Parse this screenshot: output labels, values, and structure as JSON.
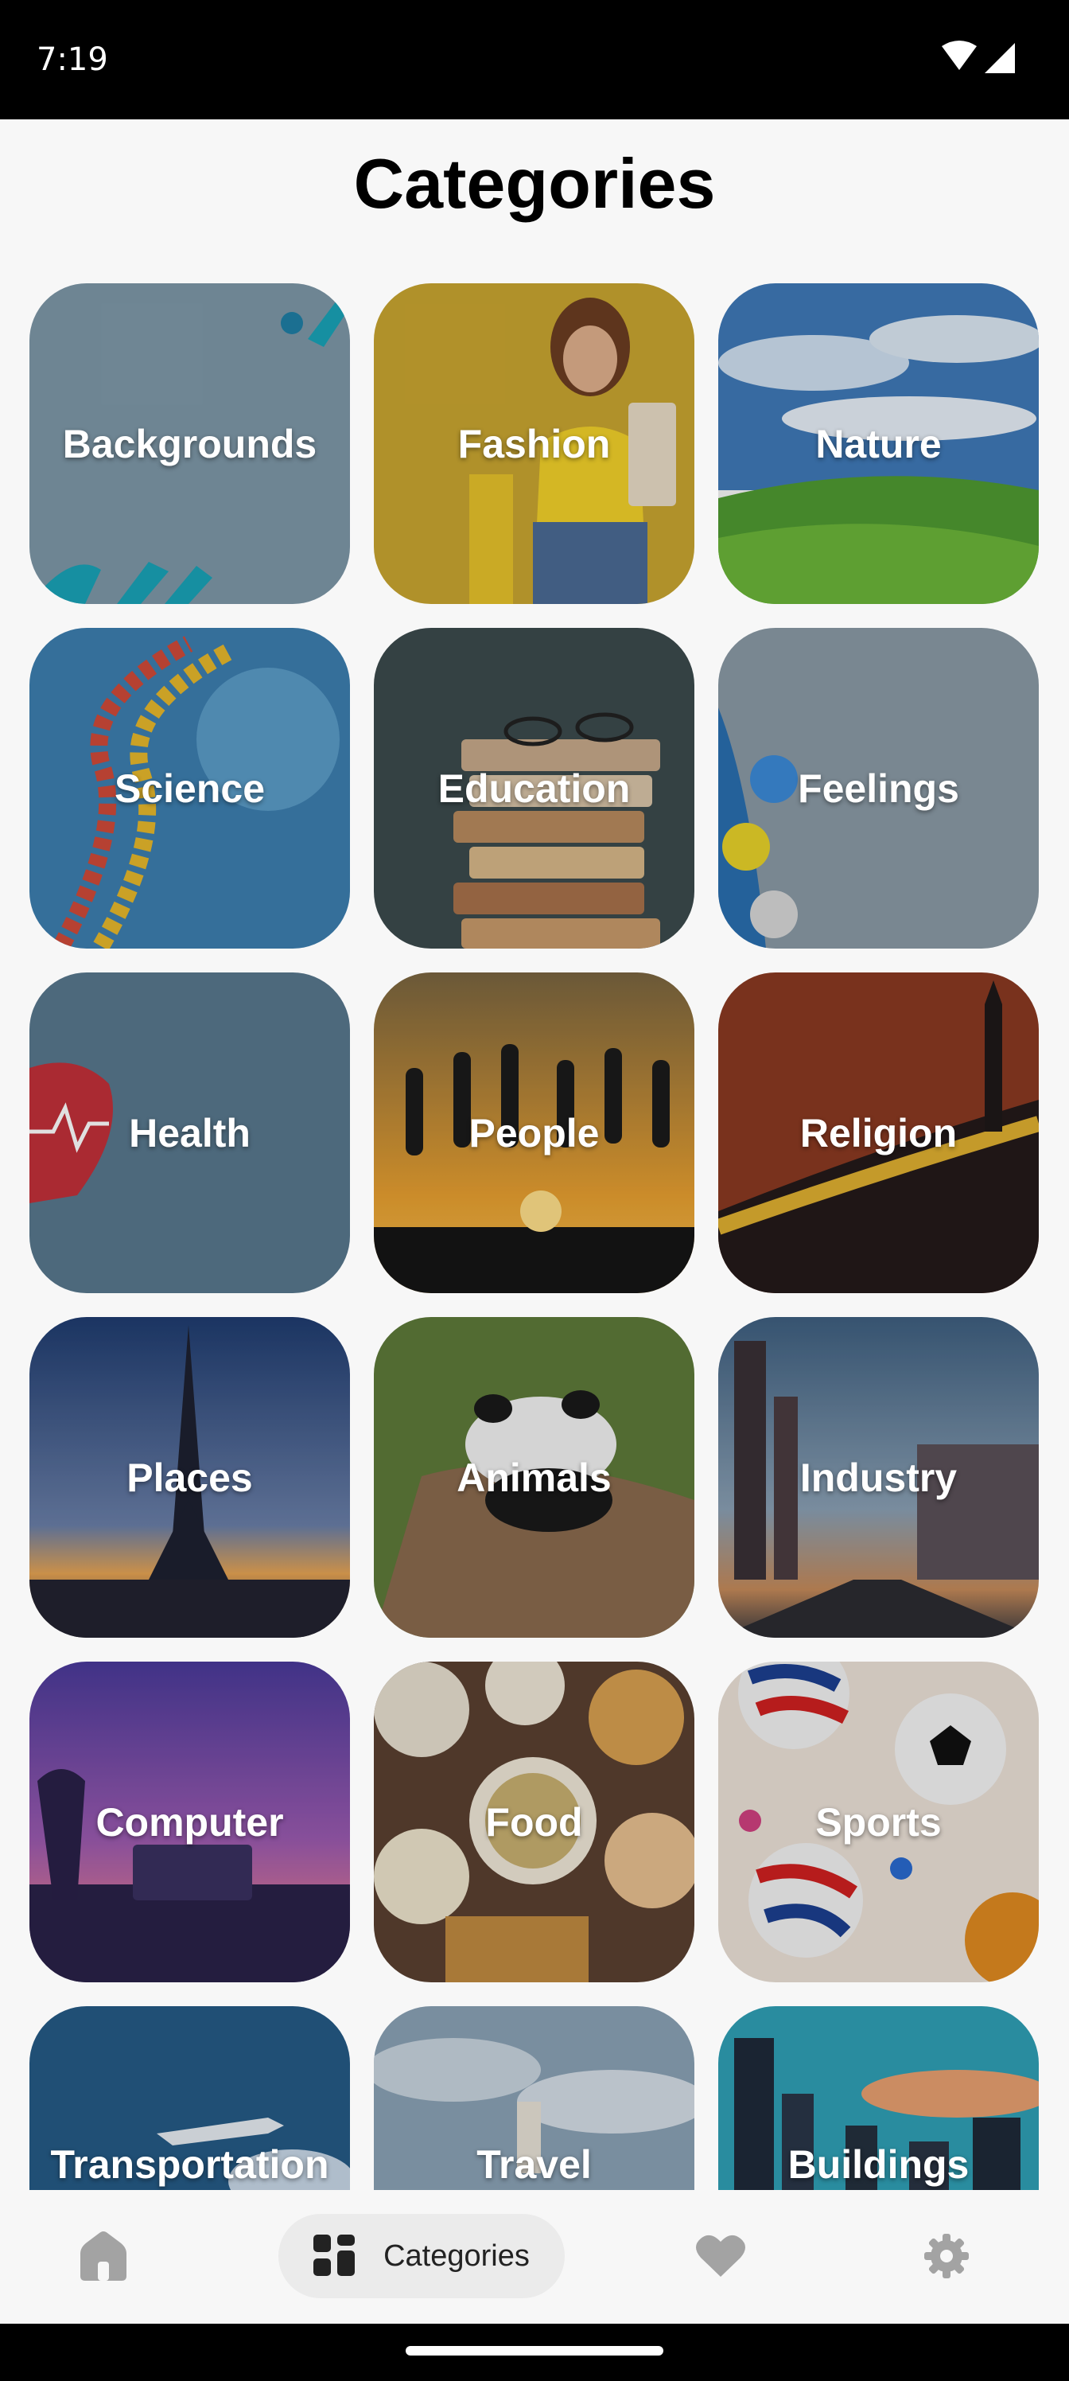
{
  "status_bar": {
    "time": "7:19"
  },
  "header": {
    "title": "Categories"
  },
  "categories": [
    {
      "label": "Backgrounds"
    },
    {
      "label": "Fashion"
    },
    {
      "label": "Nature"
    },
    {
      "label": "Science"
    },
    {
      "label": "Education"
    },
    {
      "label": "Feelings"
    },
    {
      "label": "Health"
    },
    {
      "label": "People"
    },
    {
      "label": "Religion"
    },
    {
      "label": "Places"
    },
    {
      "label": "Animals"
    },
    {
      "label": "Industry"
    },
    {
      "label": "Computer"
    },
    {
      "label": "Food"
    },
    {
      "label": "Sports"
    },
    {
      "label": "Transportation"
    },
    {
      "label": "Travel"
    },
    {
      "label": "Buildings"
    }
  ],
  "bottom_nav": {
    "items": [
      {
        "icon": "home-icon"
      },
      {
        "icon": "grid-icon",
        "label": "Categories",
        "active": true
      },
      {
        "icon": "heart-icon"
      },
      {
        "icon": "gear-icon"
      }
    ]
  },
  "colors": {
    "icon_gray": "#a3a3a3",
    "active_pill": "#ebebeb",
    "accent_dark": "#222222"
  }
}
